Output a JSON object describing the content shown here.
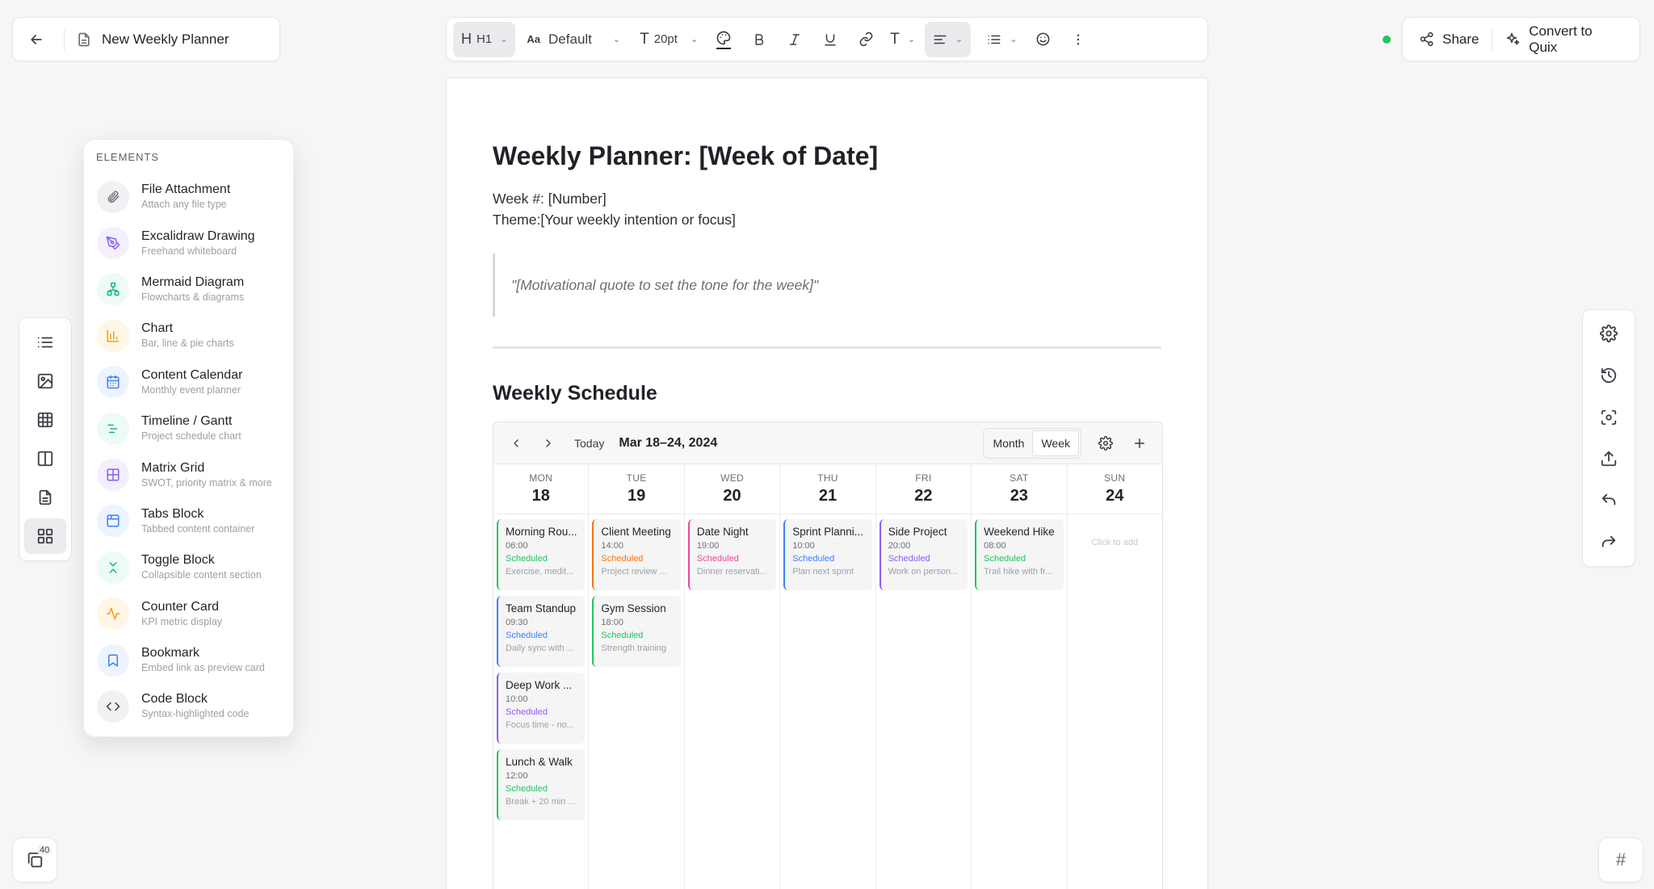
{
  "titlebar": {
    "doc_title": "New Weekly Planner"
  },
  "toolbar": {
    "heading_label": "H1",
    "font_label": "Default",
    "size_label": "20pt"
  },
  "share": {
    "share_label": "Share",
    "convert_label": "Convert to Quix",
    "status_color": "#22c55e"
  },
  "elements": {
    "heading": "ELEMENTS",
    "items": [
      {
        "name": "File Attachment",
        "desc": "Attach any file type",
        "icon": "paperclip-icon",
        "color": "#6b7078",
        "bg": "#f1f1f3"
      },
      {
        "name": "Excalidraw Drawing",
        "desc": "Freehand whiteboard",
        "icon": "pen-tool-icon",
        "color": "#8b5cf6",
        "bg": "#f3efff"
      },
      {
        "name": "Mermaid Diagram",
        "desc": "Flowcharts & diagrams",
        "icon": "network-icon",
        "color": "#10b981",
        "bg": "#ecfbf4"
      },
      {
        "name": "Chart",
        "desc": "Bar, line & pie charts",
        "icon": "bar-chart-icon",
        "color": "#f59e0b",
        "bg": "#fff6e6"
      },
      {
        "name": "Content Calendar",
        "desc": "Monthly event planner",
        "icon": "calendar-icon",
        "color": "#3b82f6",
        "bg": "#edf3ff"
      },
      {
        "name": "Timeline / Gantt",
        "desc": "Project schedule chart",
        "icon": "gantt-icon",
        "color": "#10b981",
        "bg": "#ecfbf4"
      },
      {
        "name": "Matrix Grid",
        "desc": "SWOT, priority matrix & more",
        "icon": "grid-icon",
        "color": "#8b5cf6",
        "bg": "#f3efff"
      },
      {
        "name": "Tabs Block",
        "desc": "Tabbed content container",
        "icon": "tabs-icon",
        "color": "#3b82f6",
        "bg": "#edf3ff"
      },
      {
        "name": "Toggle Block",
        "desc": "Collapsible content section",
        "icon": "collapse-icon",
        "color": "#10b981",
        "bg": "#ecfbf4"
      },
      {
        "name": "Counter Card",
        "desc": "KPI metric display",
        "icon": "activity-icon",
        "color": "#f59e0b",
        "bg": "#fff6e6"
      },
      {
        "name": "Bookmark",
        "desc": "Embed link as preview card",
        "icon": "bookmark-icon",
        "color": "#3b82f6",
        "bg": "#edf3ff"
      },
      {
        "name": "Code Block",
        "desc": "Syntax-highlighted code",
        "icon": "code-icon",
        "color": "#3b3f46",
        "bg": "#f1f1f3"
      }
    ]
  },
  "doc": {
    "h1": "Weekly Planner: [Week of Date]",
    "week": "Week #: [Number]",
    "theme": "Theme:[Your weekly intention or focus]",
    "quote": "\"[Motivational quote to set the tone for the week]\"",
    "h2": "Weekly Schedule"
  },
  "calendar": {
    "today_label": "Today",
    "range": "Mar 18–24, 2024",
    "view_month": "Month",
    "view_week": "Week",
    "click_to_add": "Click to add",
    "days": [
      {
        "dow": "MON",
        "num": "18",
        "events": [
          {
            "title": "Morning Rou...",
            "time": "06:00",
            "status": "Scheduled",
            "desc": "Exercise, medit...",
            "color": "#22c55e"
          },
          {
            "title": "Team Standup",
            "time": "09:30",
            "status": "Scheduled",
            "desc": "Daily sync with ...",
            "color": "#3b82f6"
          },
          {
            "title": "Deep Work ...",
            "time": "10:00",
            "status": "Scheduled",
            "desc": "Focus time - no...",
            "color": "#8b5cf6"
          },
          {
            "title": "Lunch & Walk",
            "time": "12:00",
            "status": "Scheduled",
            "desc": "Break + 20 min ...",
            "color": "#22c55e"
          }
        ]
      },
      {
        "dow": "TUE",
        "num": "19",
        "events": [
          {
            "title": "Client Meeting",
            "time": "14:00",
            "status": "Scheduled",
            "desc": "Project review ...",
            "color": "#f97316"
          },
          {
            "title": "Gym Session",
            "time": "18:00",
            "status": "Scheduled",
            "desc": "Strength training",
            "color": "#22c55e"
          }
        ]
      },
      {
        "dow": "WED",
        "num": "20",
        "events": [
          {
            "title": "Date Night",
            "time": "19:00",
            "status": "Scheduled",
            "desc": "Dinner reservati...",
            "color": "#ec4899"
          }
        ]
      },
      {
        "dow": "THU",
        "num": "21",
        "events": [
          {
            "title": "Sprint Planni...",
            "time": "10:00",
            "status": "Scheduled",
            "desc": "Plan next sprint",
            "color": "#3b82f6"
          }
        ]
      },
      {
        "dow": "FRI",
        "num": "22",
        "events": [
          {
            "title": "Side Project",
            "time": "20:00",
            "status": "Scheduled",
            "desc": "Work on person...",
            "color": "#8b5cf6"
          }
        ]
      },
      {
        "dow": "SAT",
        "num": "23",
        "events": [
          {
            "title": "Weekend Hike",
            "time": "08:00",
            "status": "Scheduled",
            "desc": "Trail hike with fr...",
            "color": "#22c55e"
          }
        ]
      },
      {
        "dow": "SUN",
        "num": "24",
        "events": []
      }
    ]
  },
  "pages": {
    "count": "40"
  },
  "hash": {
    "label": "#"
  }
}
